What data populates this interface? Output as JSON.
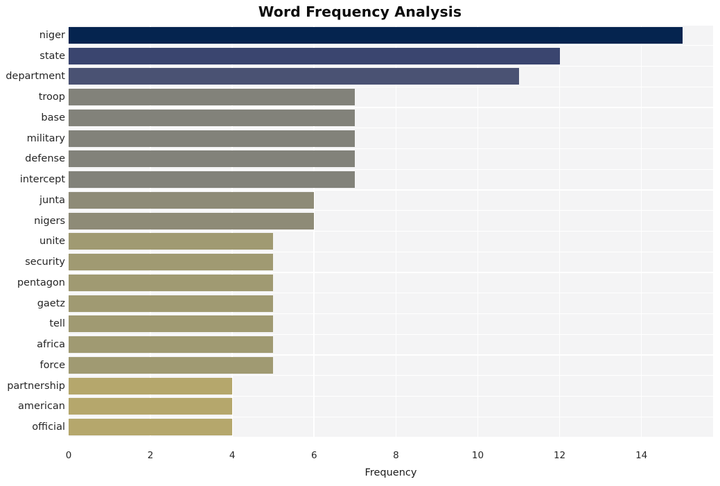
{
  "chart_data": {
    "type": "bar",
    "orientation": "horizontal",
    "title": "Word Frequency Analysis",
    "xlabel": "Frequency",
    "ylabel": "",
    "categories": [
      "niger",
      "state",
      "department",
      "troop",
      "base",
      "military",
      "defense",
      "intercept",
      "junta",
      "nigers",
      "unite",
      "security",
      "pentagon",
      "gaetz",
      "tell",
      "africa",
      "force",
      "partnership",
      "american",
      "official"
    ],
    "values": [
      15,
      12,
      11,
      7,
      7,
      7,
      7,
      7,
      6,
      6,
      5,
      5,
      5,
      5,
      5,
      5,
      5,
      4,
      4,
      4
    ],
    "bar_colors": [
      "#05244f",
      "#3a456f",
      "#4a5273",
      "#82827a",
      "#82827a",
      "#82827a",
      "#82827a",
      "#82827a",
      "#8e8b77",
      "#8e8b77",
      "#a09a72",
      "#a09a72",
      "#a09a72",
      "#a09a72",
      "#a09a72",
      "#a09a72",
      "#a09a72",
      "#b5a76c",
      "#b5a76c",
      "#b5a76c"
    ],
    "xlim": [
      0,
      15.75
    ],
    "xticks": [
      0,
      2,
      4,
      6,
      8,
      10,
      12,
      14
    ],
    "xtick_labels": [
      "0",
      "2",
      "4",
      "6",
      "8",
      "10",
      "12",
      "14"
    ],
    "grid": true,
    "grid_color": "#ffffff",
    "plot_background": "#f4f4f5",
    "figure_background": "#ffffff",
    "legend": null,
    "legend_position": "none"
  }
}
